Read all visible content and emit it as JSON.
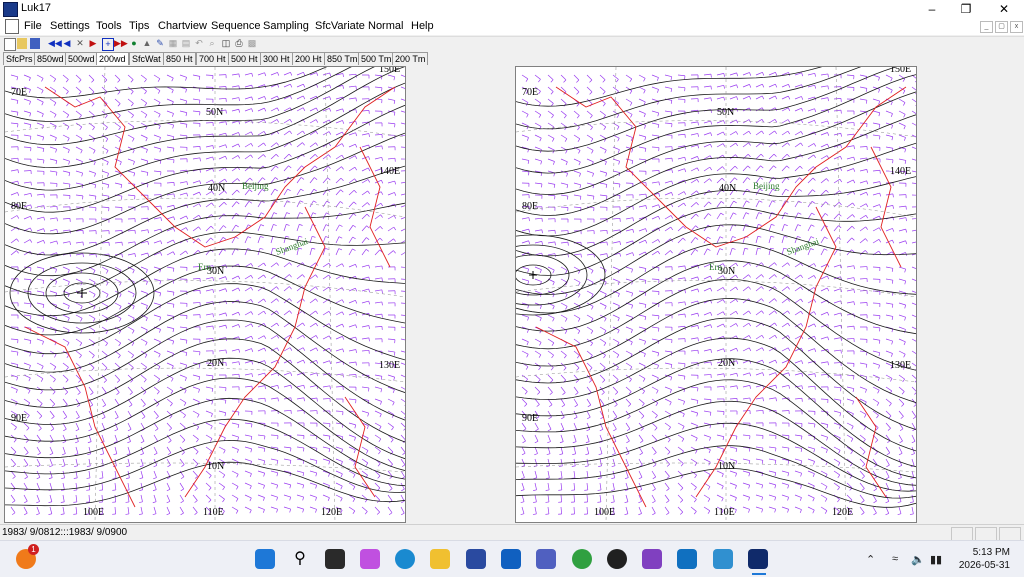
{
  "window": {
    "title": "Luk17"
  },
  "menu": [
    "File",
    "Settings",
    "Tools",
    "Tips",
    "Chartview",
    "Sequence",
    "Sampling",
    "SfcVariate",
    "Normal",
    "Help"
  ],
  "tabs": [
    "SfcPrs",
    "850wd",
    "500wd",
    "200wd",
    "SfcWat",
    "850 Ht",
    "700 Ht",
    "500 Ht",
    "300 Ht",
    "200 Ht",
    "850 Tm",
    "500 Tm",
    "200 Tm"
  ],
  "active_tab": "200wd",
  "map_labels": {
    "lon": [
      "70E",
      "80E",
      "90E",
      "100E",
      "110E",
      "120E",
      "130E",
      "140E",
      "150E"
    ],
    "lat": [
      "50N",
      "40N",
      "30N",
      "20N",
      "10N"
    ],
    "cities": [
      "Beijing",
      "Shanghai",
      "Ern"
    ]
  },
  "status": {
    "text": "1983/ 9/0812:::1983/ 9/0900"
  },
  "clock": {
    "time": "5:13 PM",
    "date": "2026-05-31"
  },
  "colors": {
    "contour": "#1a1a1a",
    "wind_barb": "#9a3cf0",
    "coast": "#e02020",
    "grid": "#888888",
    "city": "#2a7a2a"
  },
  "taskbar_icons": [
    "start-icon",
    "search-icon",
    "task-view-icon",
    "copilot-icon",
    "edge-icon",
    "file-explorer-icon",
    "store-icon",
    "outlook-icon",
    "teams-icon",
    "chrome-icon",
    "media-player-icon",
    "visual-studio-icon",
    "desktop-icon",
    "photos-icon",
    "luk17-icon"
  ]
}
